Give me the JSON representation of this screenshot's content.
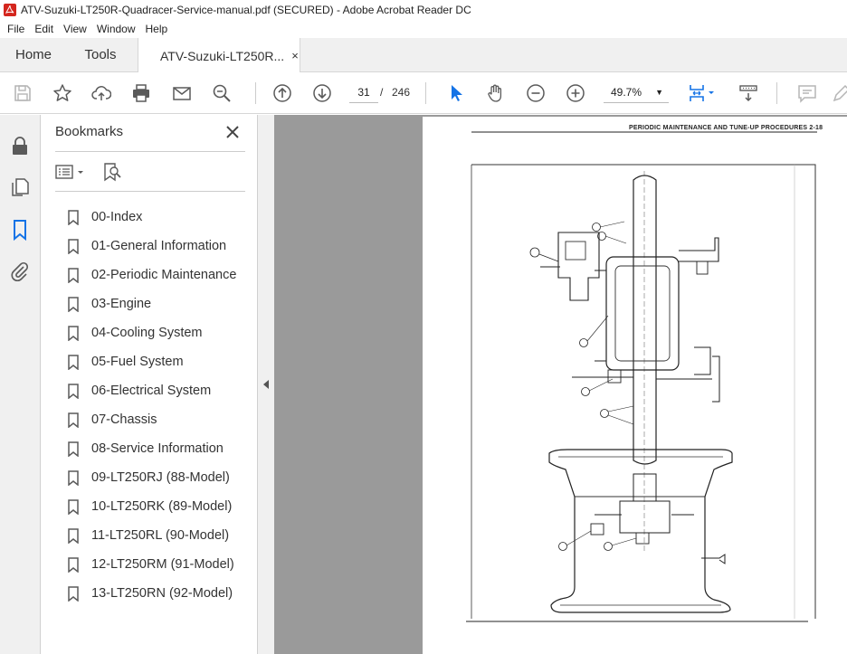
{
  "window": {
    "title": "ATV-Suzuki-LT250R-Quadracer-Service-manual.pdf (SECURED) - Adobe Acrobat Reader DC"
  },
  "menu": [
    "File",
    "Edit",
    "View",
    "Window",
    "Help"
  ],
  "tabs": {
    "home": "Home",
    "tools": "Tools",
    "doc": "ATV-Suzuki-LT250R...",
    "close": "×"
  },
  "toolbar": {
    "current_page": "31",
    "separator": "/",
    "total_pages": "246",
    "zoom": "49.7%"
  },
  "bookmarks": {
    "header": "Bookmarks",
    "items": [
      "00-Index",
      "01-General Information",
      "02-Periodic Maintenance",
      "03-Engine",
      "04-Cooling System",
      "05-Fuel System",
      "06-Electrical System",
      "07-Chassis",
      "08-Service Information",
      "09-LT250RJ (88-Model)",
      "10-LT250RK (89-Model)",
      "11-LT250RL (90-Model)",
      "12-LT250RM (91-Model)",
      "13-LT250RN (92-Model)"
    ]
  },
  "document": {
    "running_header": "PERIODIC MAINTENANCE AND TUNE-UP PROCEDURES 2-18"
  },
  "colors": {
    "accent": "#1473e6",
    "pdf_red": "#d4261e",
    "toolbar_icon": "#5a5a5a",
    "viewer_bg": "#9a9a9a"
  }
}
